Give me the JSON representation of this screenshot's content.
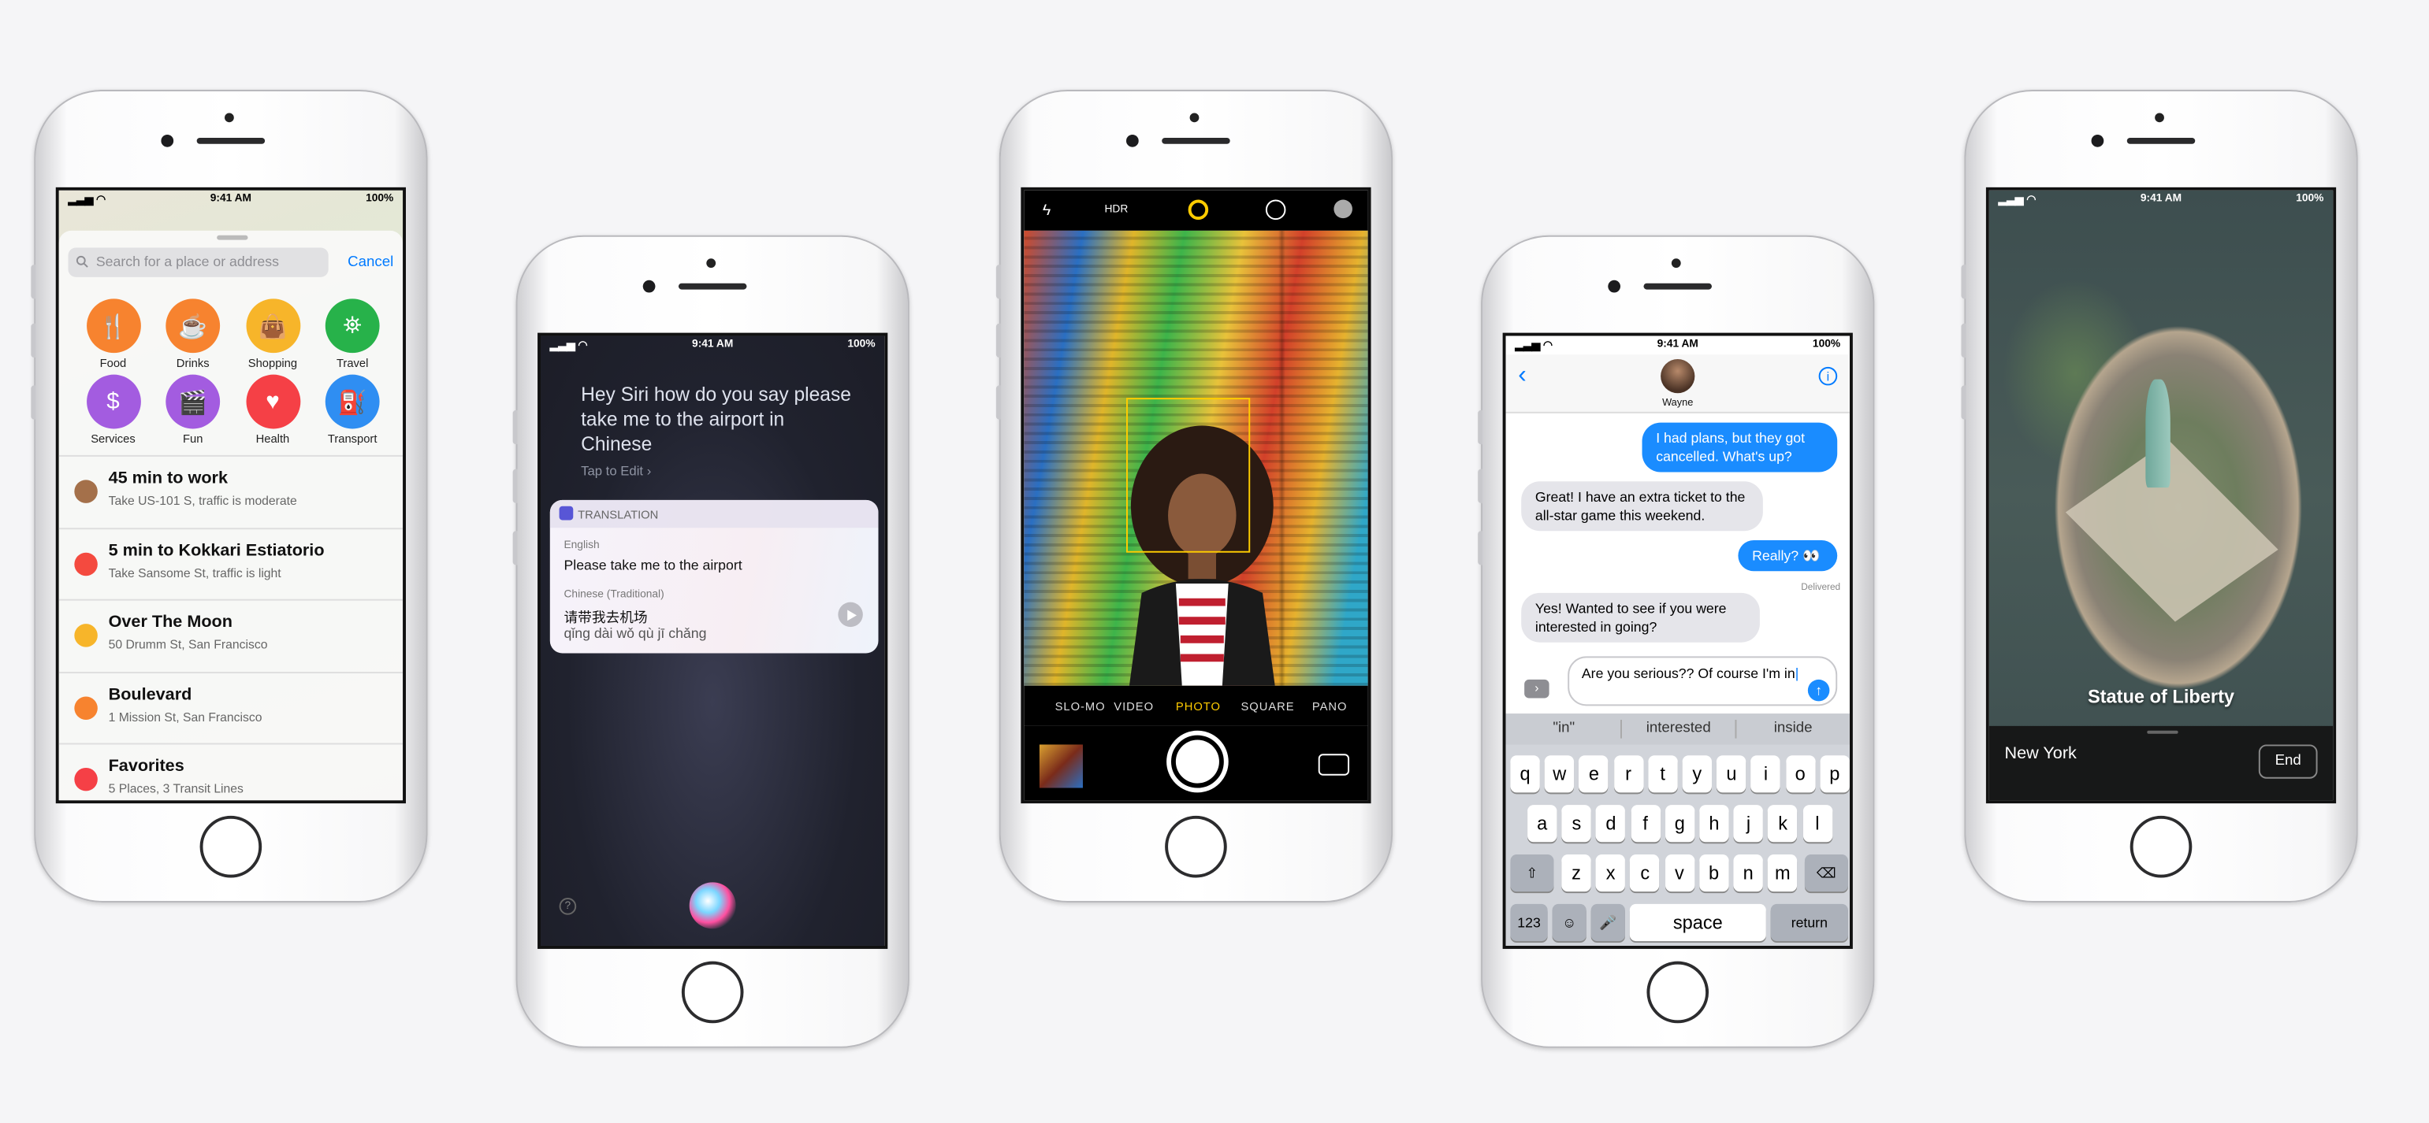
{
  "status": {
    "time": "9:41 AM",
    "battery": "100%"
  },
  "maps": {
    "search_placeholder": "Search for a place or address",
    "cancel": "Cancel",
    "categories": [
      {
        "label": "Food",
        "color": "#f7832f",
        "icon": "fork-knife-icon",
        "glyph": "🍴"
      },
      {
        "label": "Drinks",
        "color": "#f7832f",
        "icon": "cup-icon",
        "glyph": "☕"
      },
      {
        "label": "Shopping",
        "color": "#f7b52a",
        "icon": "bag-icon",
        "glyph": "👜"
      },
      {
        "label": "Travel",
        "color": "#27b24a",
        "icon": "binoculars-icon",
        "glyph": "⛯"
      },
      {
        "label": "Services",
        "color": "#a35ce0",
        "icon": "dollar-icon",
        "glyph": "$"
      },
      {
        "label": "Fun",
        "color": "#a35ce0",
        "icon": "film-icon",
        "glyph": "🎬"
      },
      {
        "label": "Health",
        "color": "#f54046",
        "icon": "heart-icon",
        "glyph": "♥"
      },
      {
        "label": "Transport",
        "color": "#2f8ef2",
        "icon": "fuel-icon",
        "glyph": "⛽"
      }
    ],
    "rows": [
      {
        "title": "45 min to work",
        "subtitle": "Take US-101 S, traffic is moderate",
        "color": "#a4704a",
        "icon": "briefcase-icon"
      },
      {
        "title": "5 min to Kokkari Estiatorio",
        "subtitle": "Take Sansome St, traffic is light",
        "color": "#f44a3f",
        "icon": "calendar-icon"
      },
      {
        "title": "Over The Moon",
        "subtitle": "50 Drumm St, San Francisco",
        "color": "#f7b52a",
        "icon": "bag-icon"
      },
      {
        "title": "Boulevard",
        "subtitle": "1 Mission St, San Francisco",
        "color": "#f7832f",
        "icon": "fork-knife-icon"
      },
      {
        "title": "Favorites",
        "subtitle": "5 Places, 3 Transit Lines",
        "color": "#f54046",
        "icon": "heart-icon"
      }
    ]
  },
  "siri": {
    "query": "Hey Siri how do you say please take me to the airport in Chinese",
    "tap_to_edit": "Tap to Edit",
    "card_title": "TRANSLATION",
    "lang1": "English",
    "text1": "Please take me to the airport",
    "lang2": "Chinese (Traditional)",
    "text2": "请带我去机场",
    "pinyin": "qǐng dài wǒ qù jī chǎng",
    "help": "?"
  },
  "camera": {
    "hdr": "HDR",
    "modes": [
      "SLO-MO",
      "VIDEO",
      "PHOTO",
      "SQUARE",
      "PANO"
    ],
    "active_mode": "PHOTO",
    "accent": "#ffcc00"
  },
  "messages": {
    "contact": "Wayne",
    "bubbles": [
      {
        "from": "me",
        "text": "I had plans, but they got cancelled. What's up?"
      },
      {
        "from": "them",
        "text": "Great! I have an extra ticket to the all-star game this weekend."
      },
      {
        "from": "me",
        "text": "Really? 👀"
      },
      {
        "from": "them",
        "text": "Yes! Wanted to see if you were interested in going?"
      }
    ],
    "delivered": "Delivered",
    "draft": "Are you serious?? Of course I'm in",
    "predictions": [
      "\"in\"",
      "interested",
      "inside"
    ],
    "row1": [
      "q",
      "w",
      "e",
      "r",
      "t",
      "y",
      "u",
      "i",
      "o",
      "p"
    ],
    "row2": [
      "a",
      "s",
      "d",
      "f",
      "g",
      "h",
      "j",
      "k",
      "l"
    ],
    "row3": [
      "z",
      "x",
      "c",
      "v",
      "b",
      "n",
      "m"
    ],
    "num_key": "123",
    "space_key": "space",
    "return_key": "return"
  },
  "liberty": {
    "place": "Statue of Liberty",
    "city": "New York",
    "end": "End"
  }
}
